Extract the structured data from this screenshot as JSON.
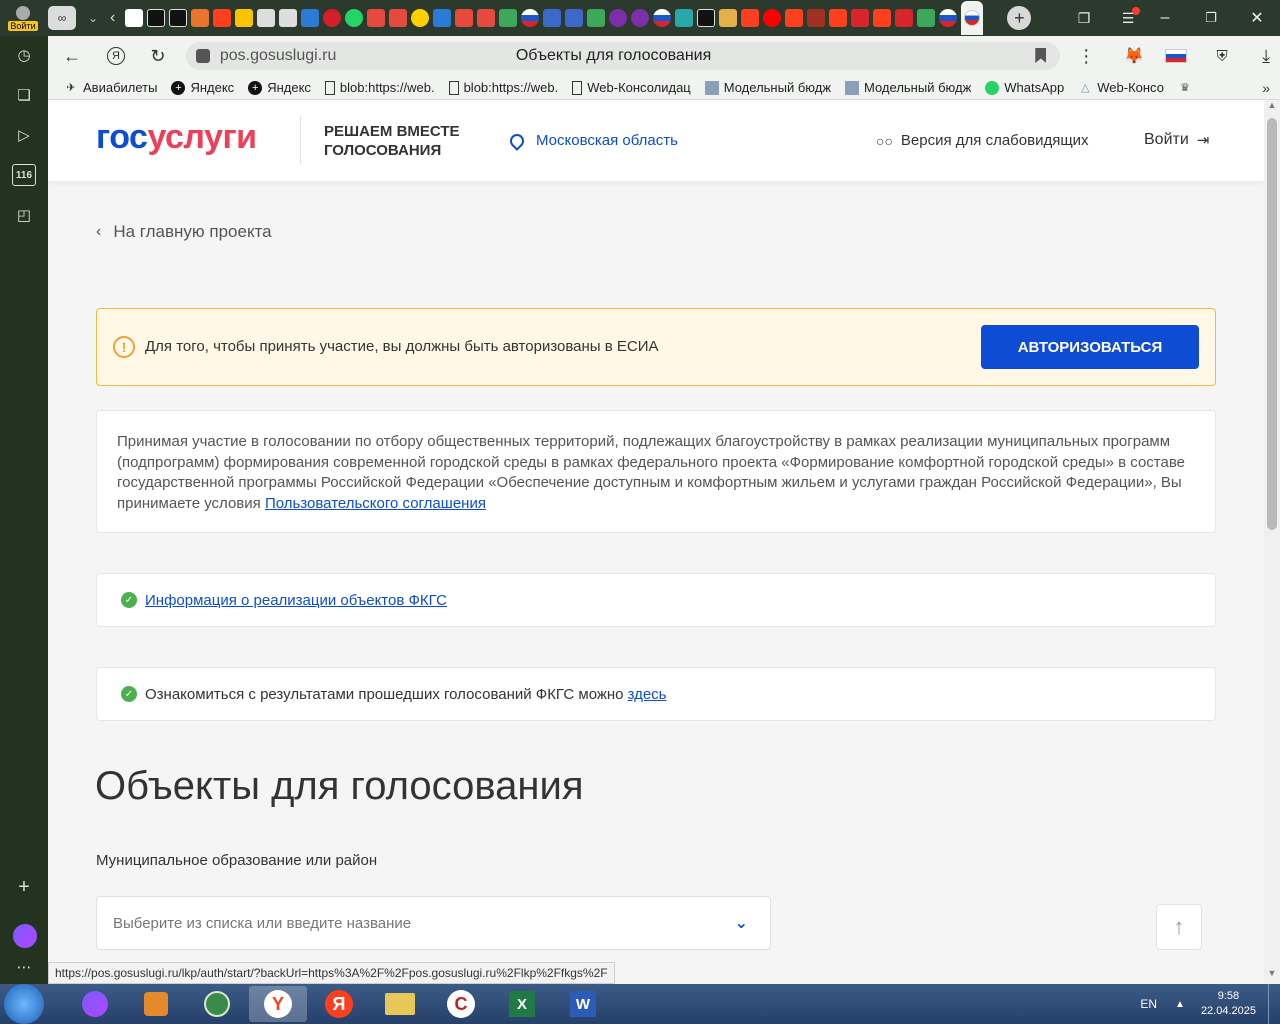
{
  "browser": {
    "login_badge": "Войти",
    "address": "pos.gosuslugi.ru",
    "page_title": "Объекты для голосования",
    "bookmarks": [
      "Авиабилеты",
      "Яндекс",
      "Яндекс",
      "blob:https://web.",
      "blob:https://web.",
      "Web-Консолидац",
      "Модельный бюдж",
      "Модельный бюдж",
      "WhatsApp",
      "Web-Консо"
    ],
    "side_counter": "116",
    "status_url": "https://pos.gosuslugi.ru/lkp/auth/start/?backUrl=https%3A%2F%2Fpos.gosuslugi.ru%2Flkp%2Ffkgs%2F"
  },
  "header": {
    "logo_part1": "гос",
    "logo_part2": "услуги",
    "tagline": "РЕШАЕМ ВМЕСТЕ ГОЛОСОВАНИЯ",
    "region": "Московская область",
    "vision": "Версия для слабовидящих",
    "login": "Войти"
  },
  "main": {
    "back_link": "На главную проекта",
    "warning_text": "Для того, чтобы принять участие, вы должны быть авторизованы в ЕСИА",
    "auth_button": "АВТОРИЗОВАТЬСЯ",
    "terms_text": "Принимая участие в голосовании по отбору общественных территорий, подлежащих благоустройству в рамках реализации муниципальных программ (подпрограмм) формирования современной городской среды в рамках федерального проекта «Формирование комфортной городской среды» в составе государственной программы Российской Федерации «Обеспечение доступным и комфортным жильем и услугами граждан Российской Федерации», Вы принимаете условия",
    "terms_link": "Пользовательского соглашения",
    "info_link": "Информация о реализации объектов ФКГС",
    "results_text": "Ознакомиться с результатами прошедших голосований ФКГС можно",
    "results_link": "здесь",
    "title": "Объекты для голосования",
    "field_label": "Муниципальное образование или район",
    "select_placeholder": "Выберите из списка или введите название"
  },
  "taskbar": {
    "lang": "EN",
    "time": "9:58",
    "date": "22.04.2025"
  },
  "colors": {
    "brand_blue": "#0d4cd3",
    "brand_red": "#ee3f58",
    "warning_border": "#f0ba45",
    "success_green": "#4caf50"
  }
}
